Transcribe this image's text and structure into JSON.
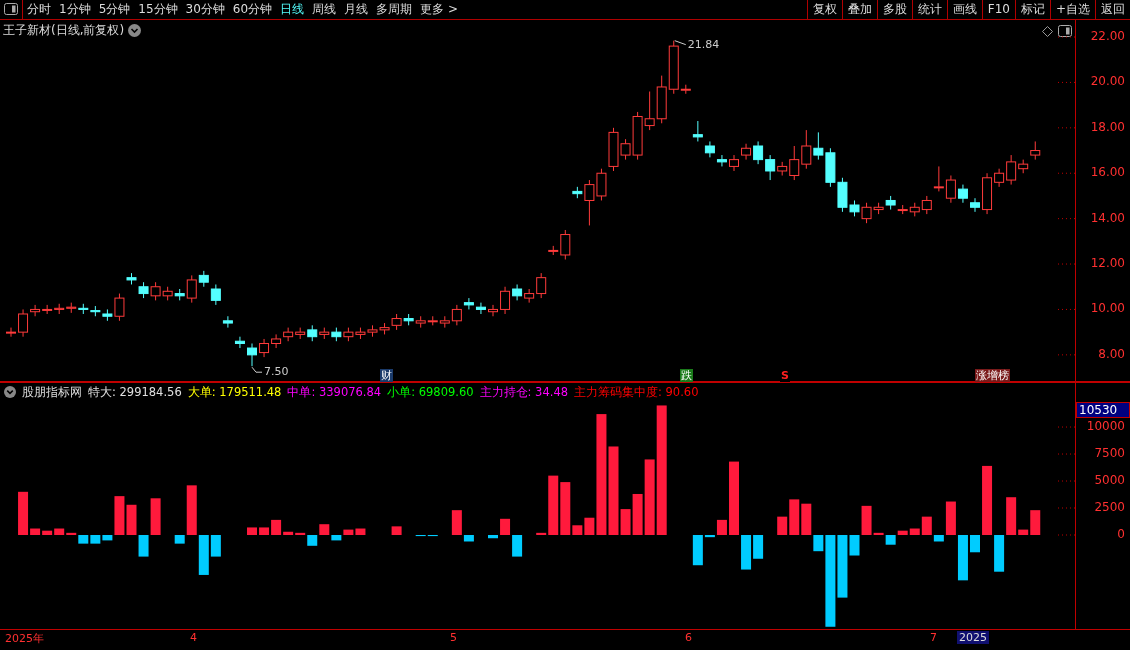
{
  "toolbar": {
    "periods": [
      {
        "label": "分时",
        "selected": false
      },
      {
        "label": "1分钟",
        "selected": false
      },
      {
        "label": "5分钟",
        "selected": false
      },
      {
        "label": "15分钟",
        "selected": false
      },
      {
        "label": "30分钟",
        "selected": false
      },
      {
        "label": "60分钟",
        "selected": false
      },
      {
        "label": "日线",
        "selected": true
      },
      {
        "label": "周线",
        "selected": false
      },
      {
        "label": "月线",
        "selected": false
      },
      {
        "label": "多周期",
        "selected": false
      },
      {
        "label": "更多 >",
        "selected": false
      }
    ],
    "actions": [
      "复权",
      "叠加",
      "多股",
      "统计",
      "画线",
      "F10",
      "标记",
      "+自选",
      "返回"
    ]
  },
  "price_chart": {
    "title": "王子新材(日线,前复权)",
    "high_label": "21.84",
    "low_label": "7.50",
    "events": [
      {
        "text": "财",
        "color": "#1a3a6a"
      },
      {
        "text": "跌",
        "color": "#1a7a1a"
      },
      {
        "text": "S",
        "color": "#000000"
      },
      {
        "text": "涨增榜",
        "color": "#7a1a1a"
      }
    ],
    "chart_data": {
      "type": "candlestick",
      "ylim": [
        6.76,
        22.75
      ],
      "yticks": [
        {
          "value": 22,
          "label": "22.00"
        },
        {
          "value": 20,
          "label": "20.00"
        },
        {
          "value": 18,
          "label": "18.00"
        },
        {
          "value": 16,
          "label": "16.00"
        },
        {
          "value": 14,
          "label": "14.00"
        },
        {
          "value": 12,
          "label": "12.00"
        },
        {
          "value": 10,
          "label": "10.00"
        },
        {
          "value": 8,
          "label": "8.00"
        }
      ],
      "ohlc": [
        [
          9.0,
          9.2,
          8.8,
          9.0
        ],
        [
          9.0,
          10.0,
          8.8,
          9.8
        ],
        [
          9.9,
          10.2,
          9.7,
          10.0
        ],
        [
          10.0,
          10.2,
          9.8,
          10.0
        ],
        [
          10.0,
          10.25,
          9.8,
          10.05
        ],
        [
          10.05,
          10.3,
          9.85,
          10.1
        ],
        [
          10.05,
          10.25,
          9.8,
          10.0
        ],
        [
          9.95,
          10.15,
          9.7,
          9.9
        ],
        [
          9.8,
          10.0,
          9.5,
          9.7
        ],
        [
          9.7,
          10.7,
          9.5,
          10.5
        ],
        [
          11.4,
          11.6,
          11.1,
          11.3
        ],
        [
          11.0,
          11.2,
          10.5,
          10.7
        ],
        [
          10.6,
          11.2,
          10.4,
          11.0
        ],
        [
          10.6,
          11.0,
          10.4,
          10.8
        ],
        [
          10.7,
          10.9,
          10.4,
          10.6
        ],
        [
          10.5,
          11.5,
          10.3,
          11.3
        ],
        [
          11.5,
          11.7,
          11.0,
          11.2
        ],
        [
          10.9,
          11.1,
          10.2,
          10.4
        ],
        [
          9.5,
          9.7,
          9.2,
          9.4
        ],
        [
          8.6,
          8.8,
          8.3,
          8.5
        ],
        [
          8.3,
          8.5,
          7.5,
          8.0
        ],
        [
          8.1,
          8.7,
          7.9,
          8.5
        ],
        [
          8.5,
          8.9,
          8.3,
          8.7
        ],
        [
          8.8,
          9.2,
          8.6,
          9.0
        ],
        [
          8.9,
          9.2,
          8.7,
          9.0
        ],
        [
          9.1,
          9.3,
          8.6,
          8.8
        ],
        [
          8.9,
          9.2,
          8.7,
          9.0
        ],
        [
          9.0,
          9.2,
          8.6,
          8.8
        ],
        [
          8.8,
          9.2,
          8.6,
          9.0
        ],
        [
          8.9,
          9.2,
          8.7,
          9.0
        ],
        [
          9.0,
          9.3,
          8.8,
          9.1
        ],
        [
          9.1,
          9.4,
          8.9,
          9.2
        ],
        [
          9.3,
          9.8,
          9.1,
          9.6
        ],
        [
          9.6,
          9.8,
          9.3,
          9.5
        ],
        [
          9.4,
          9.7,
          9.2,
          9.5
        ],
        [
          9.5,
          9.7,
          9.3,
          9.5
        ],
        [
          9.4,
          9.7,
          9.2,
          9.5
        ],
        [
          9.5,
          10.2,
          9.3,
          10.0
        ],
        [
          10.3,
          10.5,
          10.0,
          10.2
        ],
        [
          10.1,
          10.3,
          9.8,
          10.0
        ],
        [
          9.9,
          10.2,
          9.7,
          10.0
        ],
        [
          10.0,
          11.0,
          9.8,
          10.8
        ],
        [
          10.9,
          11.1,
          10.4,
          10.6
        ],
        [
          10.5,
          10.9,
          10.3,
          10.7
        ],
        [
          10.7,
          11.6,
          10.5,
          11.4
        ],
        [
          12.6,
          12.8,
          12.4,
          12.6
        ],
        [
          12.4,
          13.5,
          12.2,
          13.3
        ],
        [
          15.2,
          15.4,
          14.9,
          15.1
        ],
        [
          14.8,
          15.7,
          13.7,
          15.5
        ],
        [
          15.0,
          16.2,
          14.8,
          16.0
        ],
        [
          16.3,
          18.0,
          16.1,
          17.8
        ],
        [
          16.8,
          17.5,
          16.6,
          17.3
        ],
        [
          16.8,
          18.7,
          16.6,
          18.5
        ],
        [
          18.1,
          19.6,
          17.9,
          18.4
        ],
        [
          18.4,
          20.3,
          18.2,
          19.8
        ],
        [
          19.7,
          21.84,
          19.5,
          21.6
        ],
        [
          19.7,
          19.9,
          19.5,
          19.7
        ],
        [
          17.7,
          18.3,
          17.4,
          17.6
        ],
        [
          17.2,
          17.4,
          16.7,
          16.9
        ],
        [
          16.6,
          16.8,
          16.3,
          16.5
        ],
        [
          16.3,
          16.8,
          16.1,
          16.6
        ],
        [
          16.8,
          17.3,
          16.6,
          17.1
        ],
        [
          17.2,
          17.4,
          16.4,
          16.6
        ],
        [
          16.6,
          16.8,
          15.7,
          16.1
        ],
        [
          16.1,
          16.5,
          15.9,
          16.3
        ],
        [
          15.9,
          17.2,
          15.7,
          16.6
        ],
        [
          16.4,
          17.9,
          16.2,
          17.2
        ],
        [
          17.1,
          17.8,
          16.6,
          16.8
        ],
        [
          16.9,
          17.1,
          15.4,
          15.6
        ],
        [
          15.6,
          15.8,
          14.3,
          14.5
        ],
        [
          14.6,
          14.8,
          14.1,
          14.3
        ],
        [
          14.0,
          14.7,
          13.8,
          14.5
        ],
        [
          14.4,
          14.7,
          14.2,
          14.5
        ],
        [
          14.8,
          15.0,
          14.4,
          14.6
        ],
        [
          14.4,
          14.6,
          14.2,
          14.4
        ],
        [
          14.3,
          14.7,
          14.1,
          14.5
        ],
        [
          14.4,
          15.0,
          14.2,
          14.8
        ],
        [
          15.4,
          16.3,
          15.2,
          15.4
        ],
        [
          14.9,
          15.9,
          14.7,
          15.7
        ],
        [
          15.3,
          15.5,
          14.7,
          14.9
        ],
        [
          14.7,
          14.9,
          14.3,
          14.5
        ],
        [
          14.4,
          16.0,
          14.2,
          15.8
        ],
        [
          15.6,
          16.2,
          15.4,
          16.0
        ],
        [
          15.7,
          16.8,
          15.5,
          16.5
        ],
        [
          16.2,
          16.6,
          16.0,
          16.4
        ],
        [
          16.8,
          17.4,
          16.6,
          17.0
        ]
      ]
    }
  },
  "indicator": {
    "name": "股朋指标网",
    "items": [
      {
        "text": "特大: 299184.56",
        "color": "#e0e0e0"
      },
      {
        "text": "大单: 179511.48",
        "color": "#ffff00"
      },
      {
        "text": "中单: 339076.84",
        "color": "#ff00ff"
      },
      {
        "text": "小单: 69809.60",
        "color": "#00ff00"
      },
      {
        "text": "主力持仓: 34.48",
        "color": "#ff00ff"
      },
      {
        "text": "主力筹码集中度: 90.60",
        "color": "#ff0000"
      }
    ],
    "current_value": "10530",
    "chart_data": {
      "type": "bar",
      "ylim": [
        -8800,
        14080
      ],
      "yticks": [
        {
          "value": 10000,
          "label": "10000"
        },
        {
          "value": 7500,
          "label": "7500"
        },
        {
          "value": 5000,
          "label": "5000"
        },
        {
          "value": 2500,
          "label": "2500"
        },
        {
          "value": 0,
          "label": "0"
        }
      ],
      "values": [
        0,
        4000,
        600,
        400,
        600,
        200,
        -800,
        -800,
        -500,
        3600,
        2800,
        -2000,
        3400,
        0,
        -800,
        4600,
        -3700,
        -2000,
        0,
        0,
        700,
        700,
        1400,
        300,
        200,
        -1000,
        1000,
        -500,
        500,
        600,
        0,
        0,
        800,
        0,
        -100,
        -100,
        0,
        2300,
        -600,
        0,
        -300,
        1500,
        -2000,
        0,
        200,
        5500,
        4900,
        900,
        1600,
        11200,
        8200,
        2400,
        3800,
        7000,
        12000,
        0,
        0,
        -2800,
        -200,
        1400,
        6800,
        -3200,
        -2200,
        0,
        1700,
        3300,
        2900,
        -1500,
        -8500,
        -5800,
        -1900,
        2700,
        200,
        -900,
        400,
        600,
        1700,
        -600,
        3100,
        -4200,
        -1600,
        6400,
        -3400,
        3500,
        500,
        2300
      ]
    }
  },
  "date_axis": {
    "labels": [
      "2025年",
      "4",
      "5",
      "6",
      "7"
    ],
    "current": "2025"
  }
}
